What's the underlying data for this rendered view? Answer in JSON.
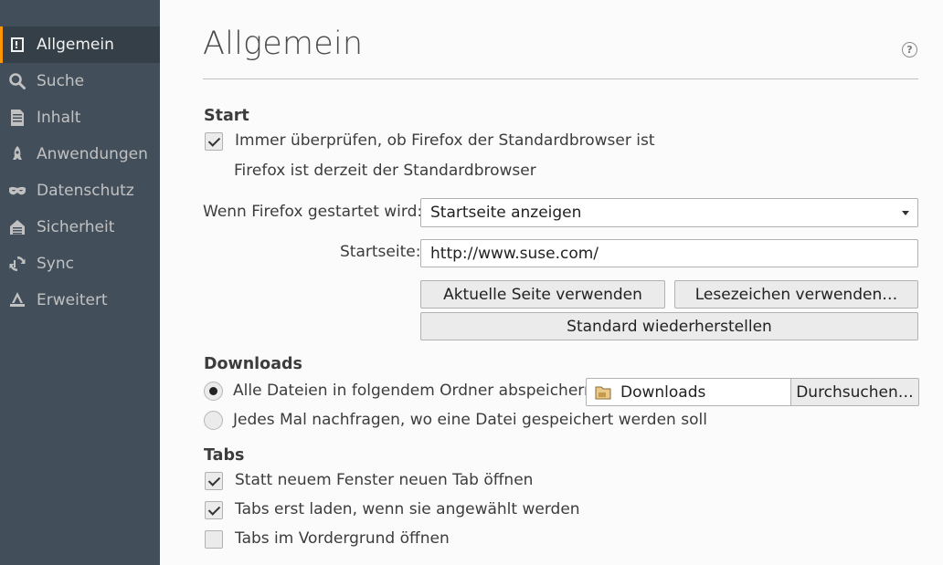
{
  "sidebar": {
    "items": [
      {
        "label": "Allgemein",
        "icon": "general-icon"
      },
      {
        "label": "Suche",
        "icon": "search-icon"
      },
      {
        "label": "Inhalt",
        "icon": "content-icon"
      },
      {
        "label": "Anwendungen",
        "icon": "applications-icon"
      },
      {
        "label": "Datenschutz",
        "icon": "privacy-mask-icon"
      },
      {
        "label": "Sicherheit",
        "icon": "security-icon"
      },
      {
        "label": "Sync",
        "icon": "sync-icon"
      },
      {
        "label": "Erweitert",
        "icon": "advanced-icon"
      }
    ],
    "selected": "Allgemein"
  },
  "header": {
    "title": "Allgemein",
    "help_icon": "help-icon"
  },
  "start": {
    "title": "Start",
    "check_default_label": "Immer überprüfen, ob Firefox der Standardbrowser ist",
    "check_default_checked": true,
    "status_text": "Firefox ist derzeit der Standardbrowser",
    "on_start_label": "Wenn Firefox gestartet wird:",
    "on_start_value": "Startseite anzeigen",
    "homepage_label": "Startseite:",
    "homepage_value": "http://www.suse.com/",
    "use_current_label": "Aktuelle Seite verwenden",
    "use_bookmark_label": "Lesezeichen verwenden…",
    "restore_default_label": "Standard wiederherstellen"
  },
  "downloads": {
    "title": "Downloads",
    "save_to_label": "Alle Dateien in folgendem Ordner abspeichern:",
    "save_to_selected": true,
    "folder_name": "Downloads",
    "browse_label": "Durchsuchen…",
    "always_ask_label": "Jedes Mal nachfragen, wo eine Datei gespeichert werden soll",
    "always_ask_selected": false
  },
  "tabs": {
    "title": "Tabs",
    "items": [
      {
        "label": "Statt neuem Fenster neuen Tab öffnen",
        "checked": true
      },
      {
        "label": "Tabs erst laden, wenn sie angewählt werden",
        "checked": true
      },
      {
        "label": "Tabs im Vordergrund öffnen",
        "checked": false
      }
    ]
  },
  "colors": {
    "sidebar_bg": "#424f5a",
    "selected_bg": "#343f48",
    "accent": "#ff9500",
    "page_bg": "#fbfbfb"
  }
}
